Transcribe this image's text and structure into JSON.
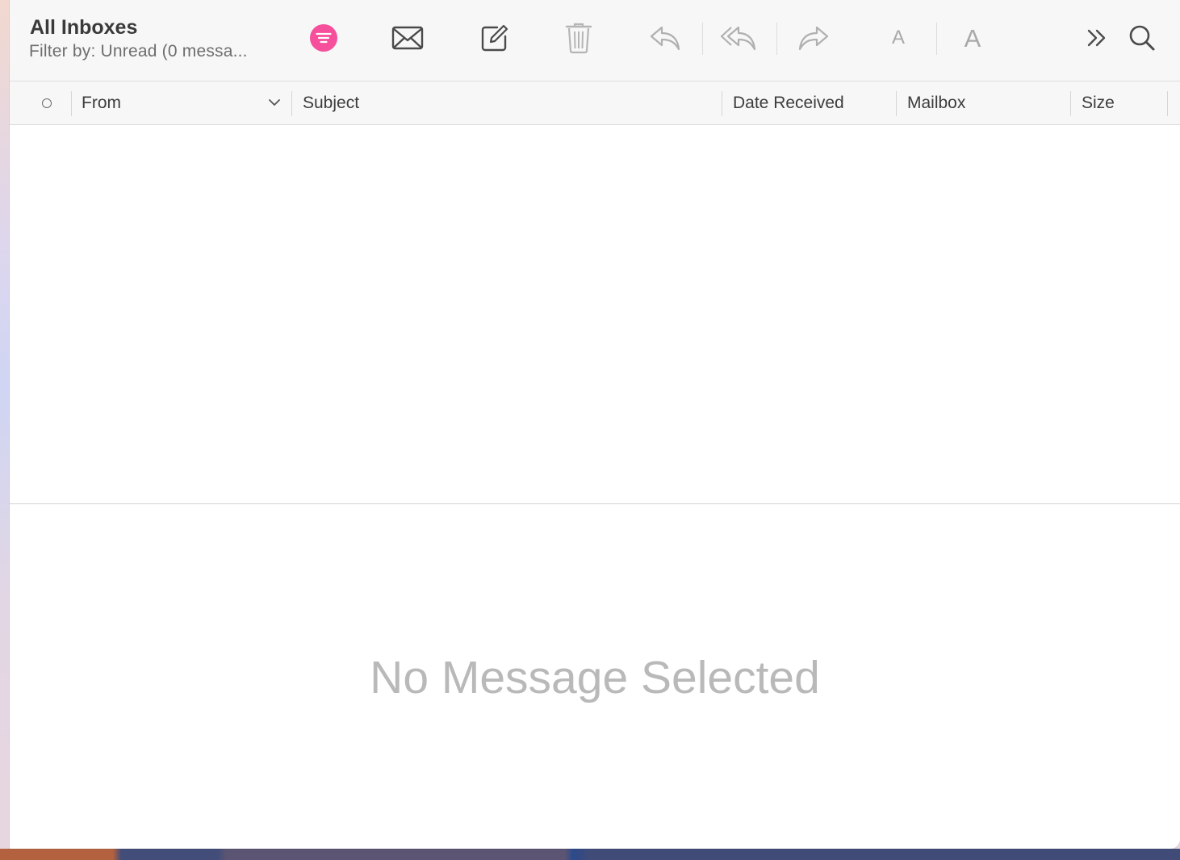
{
  "toolbar": {
    "mailbox_title": "All Inboxes",
    "mailbox_subtitle": "Filter by: Unread (0 messa...",
    "filter_button_color": "#f64f9b",
    "icons": [
      "filter-icon",
      "get-mail-icon",
      "compose-icon",
      "trash-icon",
      "reply-icon",
      "reply-all-icon",
      "forward-icon",
      "smaller-font-icon",
      "larger-font-icon",
      "more-overflow-icon",
      "search-icon"
    ],
    "smaller_font_label": "A",
    "larger_font_label": "A"
  },
  "columns": {
    "from": "From",
    "subject": "Subject",
    "date_received": "Date Received",
    "mailbox": "Mailbox",
    "size": "Size"
  },
  "messages": [],
  "preview": {
    "empty_label": "No Message Selected"
  }
}
